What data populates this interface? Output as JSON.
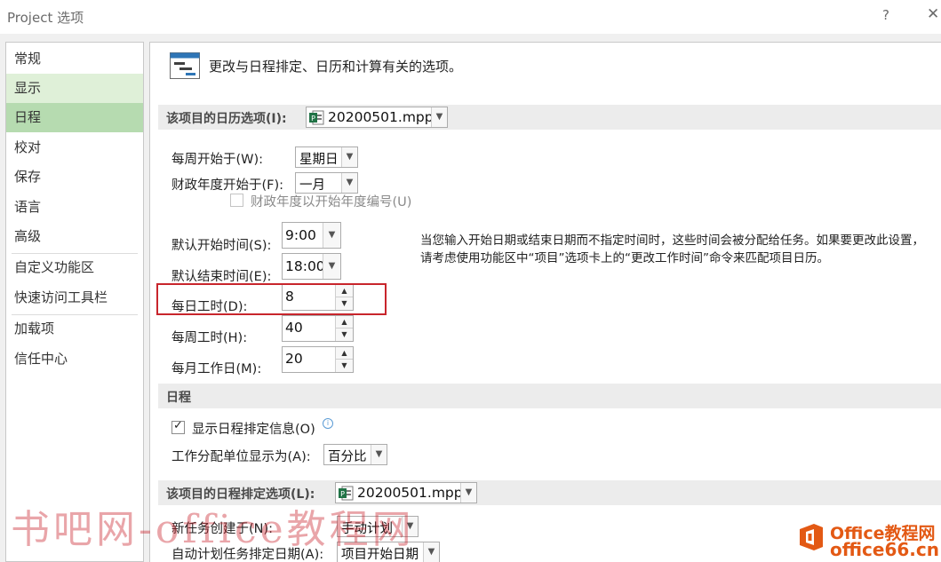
{
  "window": {
    "title": "Project 选项",
    "help": "?",
    "close": "✕"
  },
  "sidebar": {
    "items": [
      {
        "label": "常规"
      },
      {
        "label": "显示"
      },
      {
        "label": "日程"
      },
      {
        "label": "校对"
      },
      {
        "label": "保存"
      },
      {
        "label": "语言"
      },
      {
        "label": "高级"
      },
      {
        "label": "自定义功能区"
      },
      {
        "label": "快速访问工具栏"
      },
      {
        "label": "加载项"
      },
      {
        "label": "信任中心"
      }
    ],
    "hovered": "显示",
    "selected": "日程"
  },
  "header": {
    "text": "更改与日程排定、日历和计算有关的选项。",
    "icon": "schedule-options-icon"
  },
  "calendar_section": {
    "title": "该项目的日历选项(I):",
    "file": "20200501.mpp",
    "week_start_label": "每周开始于(W):",
    "week_start_value": "星期日",
    "fiscal_start_label": "财政年度开始于(F):",
    "fiscal_start_value": "一月",
    "fiscal_numbering_label": "财政年度以开始年度编号(U)",
    "default_start_label": "默认开始时间(S):",
    "default_start_value": "9:00",
    "default_end_label": "默认结束时间(E):",
    "default_end_value": "18:00",
    "hours_day_label": "每日工时(D):",
    "hours_day_value": "8",
    "hours_week_label": "每周工时(H):",
    "hours_week_value": "40",
    "days_month_label": "每月工作日(M):",
    "days_month_value": "20",
    "note": "当您输入开始日期或结束日期而不指定时间时，这些时间会被分配给任务。如果要更改此设置，请考虑使用功能区中“项目”选项卡上的“更改工作时间”命令来匹配项目日历。"
  },
  "schedule_section": {
    "title": "日程",
    "show_info_label": "显示日程排定信息(O)",
    "show_info_checked": true,
    "assignment_units_label": "工作分配单位显示为(A):",
    "assignment_units_value": "百分比"
  },
  "schedule_options_section": {
    "title": "该项目的日程排定选项(L):",
    "file": "20200501.mpp",
    "new_tasks_label": "新任务创建于(N):",
    "new_tasks_value": "手动计划",
    "auto_tasks_label": "自动计划任务排定日期(A):",
    "auto_tasks_value": "项目开始日期"
  },
  "watermarks": {
    "left": "书吧网-office教程网",
    "right_line1": "Office教程网",
    "right_line2": "office66.cn"
  },
  "colors": {
    "nav_selected": "#b6dbb0",
    "nav_hover": "#dff0d8",
    "highlight_border": "#c8252c",
    "logo_orange": "#e35914"
  }
}
